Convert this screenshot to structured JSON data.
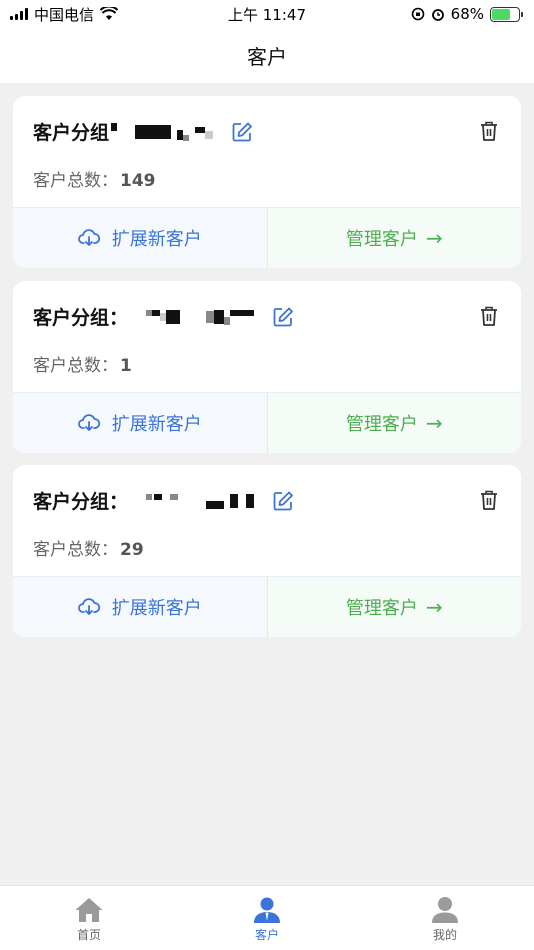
{
  "status_bar": {
    "carrier": "中国电信",
    "time": "上午 11:47",
    "battery_percent": "68%",
    "battery_level": 0.68
  },
  "header": {
    "title": "客户"
  },
  "groups": [
    {
      "label": "客户分组",
      "count_label": "客户总数：",
      "count": "149",
      "expand_label": "扩展新客户",
      "manage_label": "管理客户"
    },
    {
      "label": "客户分组：",
      "count_label": "客户总数：",
      "count": "1",
      "expand_label": "扩展新客户",
      "manage_label": "管理客户"
    },
    {
      "label": "客户分组：",
      "count_label": "客户总数：",
      "count": "29",
      "expand_label": "扩展新客户",
      "manage_label": "管理客户"
    }
  ],
  "tabs": [
    {
      "label": "首页",
      "icon": "home-icon"
    },
    {
      "label": "客户",
      "icon": "customer-icon",
      "active": true
    },
    {
      "label": "我的",
      "icon": "profile-icon"
    }
  ],
  "colors": {
    "accent": "#3a74d8",
    "manage": "#4caf50",
    "background": "#f0f0f0"
  }
}
